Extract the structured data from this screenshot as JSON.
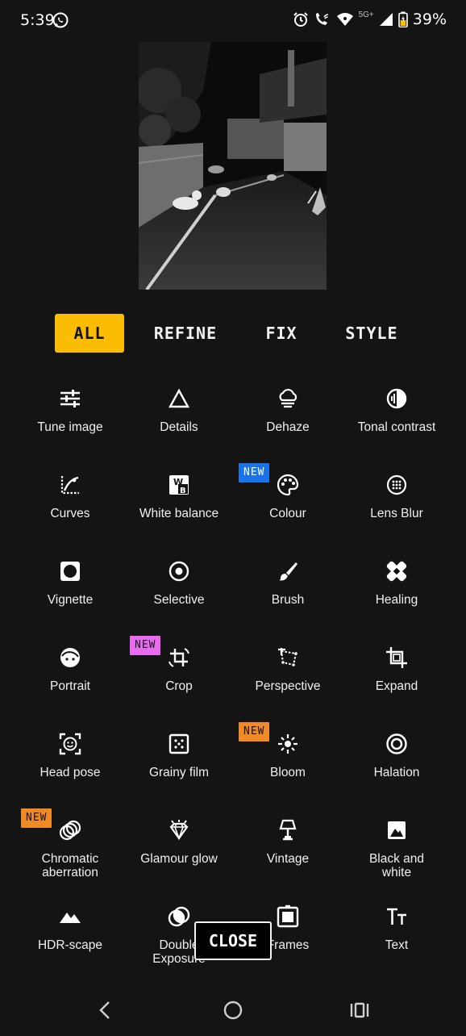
{
  "status_bar": {
    "time": "5:39",
    "network": "5G+",
    "battery": "39%",
    "icons": [
      "whatsapp-icon",
      "alarm-icon",
      "wifi-calling-icon",
      "wifi-icon",
      "signal-icon",
      "battery-icon"
    ]
  },
  "photo": {
    "description_icon": "photo-preview"
  },
  "tabs": [
    {
      "label": "ALL",
      "active": true
    },
    {
      "label": "REFINE",
      "active": false
    },
    {
      "label": "FIX",
      "active": false
    },
    {
      "label": "STYLE",
      "active": false
    }
  ],
  "tools": [
    {
      "label": "Tune image",
      "icon": "sliders-icon"
    },
    {
      "label": "Details",
      "icon": "triangle-icon"
    },
    {
      "label": "Dehaze",
      "icon": "cloud-haze-icon"
    },
    {
      "label": "Tonal contrast",
      "icon": "tonal-contrast-icon"
    },
    {
      "label": "Curves",
      "icon": "curves-icon"
    },
    {
      "label": "White balance",
      "icon": "white-balance-icon"
    },
    {
      "label": "Colour",
      "icon": "palette-icon",
      "badge": "NEW"
    },
    {
      "label": "Lens Blur",
      "icon": "lens-blur-icon"
    },
    {
      "label": "Vignette",
      "icon": "vignette-icon"
    },
    {
      "label": "Selective",
      "icon": "selective-icon"
    },
    {
      "label": "Brush",
      "icon": "brush-icon"
    },
    {
      "label": "Healing",
      "icon": "healing-icon"
    },
    {
      "label": "Portrait",
      "icon": "portrait-icon"
    },
    {
      "label": "Crop",
      "icon": "crop-rotate-icon",
      "badge": "NEW"
    },
    {
      "label": "Perspective",
      "icon": "perspective-icon"
    },
    {
      "label": "Expand",
      "icon": "expand-icon"
    },
    {
      "label": "Head pose",
      "icon": "head-pose-icon"
    },
    {
      "label": "Grainy film",
      "icon": "grainy-film-icon"
    },
    {
      "label": "Bloom",
      "icon": "bloom-icon",
      "badge": "NEW"
    },
    {
      "label": "Halation",
      "icon": "halation-icon"
    },
    {
      "label": "Chromatic\naberration",
      "icon": "chromatic-aberration-icon",
      "badge": "NEW"
    },
    {
      "label": "Glamour glow",
      "icon": "glamour-glow-icon"
    },
    {
      "label": "Vintage",
      "icon": "vintage-lamp-icon"
    },
    {
      "label": "Black and\nwhite",
      "icon": "black-white-icon"
    },
    {
      "label": "HDR-scape",
      "icon": "mountains-icon"
    },
    {
      "label": "Double\nExposure",
      "icon": "double-exposure-icon"
    },
    {
      "label": "Frames",
      "icon": "frames-icon"
    },
    {
      "label": "Text",
      "icon": "text-icon"
    }
  ],
  "badge_colors": {
    "blue": "#1a73e8",
    "pink": "#e86bf0",
    "orange": "#f08a24"
  },
  "close_button": {
    "label": "CLOSE"
  },
  "nav": {
    "back": "back-icon",
    "home": "home-icon",
    "recents": "recents-icon"
  },
  "colors": {
    "accent": "#fbbc04",
    "background": "#141414"
  }
}
